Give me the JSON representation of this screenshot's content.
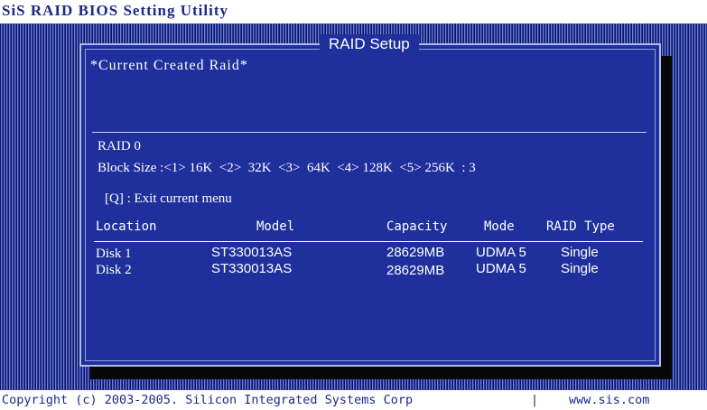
{
  "title": "SiS RAID BIOS Setting Utility",
  "panel": {
    "title": "RAID Setup",
    "current_raid_label": "*Current Created Raid*"
  },
  "raid": {
    "level": "RAID 0",
    "block_size_line": "Block Size :<1> 16K  <2>  32K  <3>  64K  <4> 128K  <5> 256K  : 3",
    "exit_hint": "[Q] : Exit current menu"
  },
  "table": {
    "columns": [
      "Location",
      "Model",
      "Capacity",
      "Mode",
      "RAID Type"
    ],
    "rows": [
      {
        "location": "Disk 1",
        "model": "ST330013AS",
        "capacity": "28629MB",
        "mode": "UDMA 5",
        "raid_type": "Single"
      },
      {
        "location": "Disk 2",
        "model": "ST330013AS",
        "capacity": "28629MB",
        "mode": "UDMA 5",
        "raid_type": "Single"
      }
    ]
  },
  "status_bar": {
    "copyright": "Copyright (c) 2003-2005. Silicon Integrated Systems Corp",
    "separator": "|",
    "website": "www.sis.com"
  },
  "colors": {
    "panel_bg": "#1f2f9b",
    "title_text": "#1a2a86",
    "background_pattern": "#2b3898"
  }
}
